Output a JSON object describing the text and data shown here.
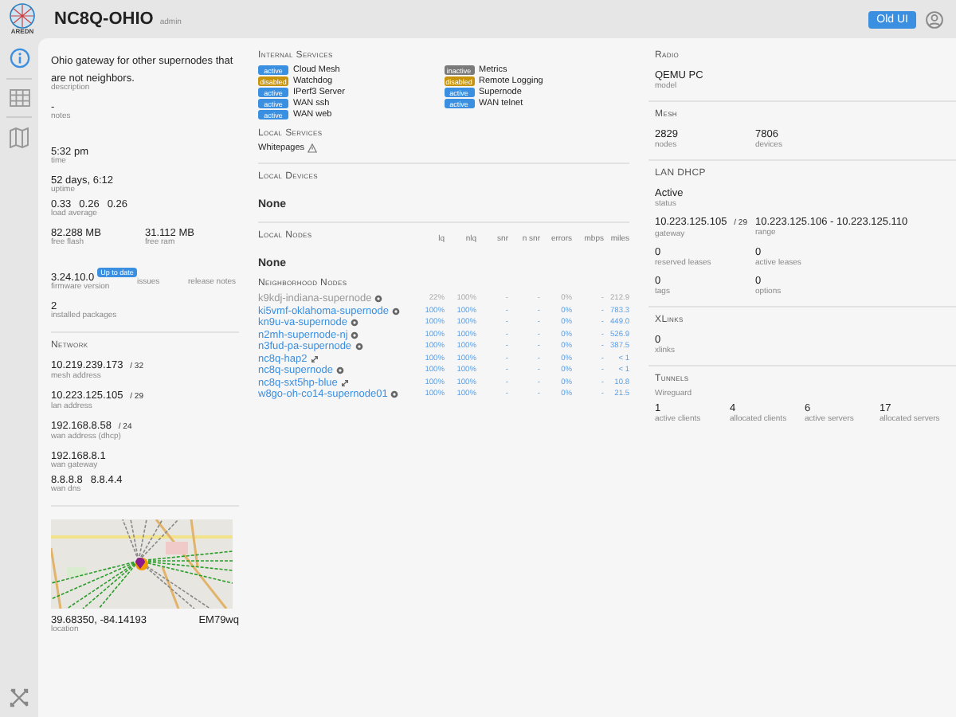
{
  "header": {
    "logo_text": "AREDN",
    "title": "NC8Q-OHIO",
    "role": "admin",
    "old_ui_button": "Old UI"
  },
  "sidebar": {
    "items": [
      {
        "kind": "status",
        "selected": true
      },
      {
        "kind": "table",
        "selected": false
      },
      {
        "kind": "map",
        "selected": false
      }
    ]
  },
  "overview": {
    "rows": [
      {
        "gap_before": false,
        "cells": [
          {
            "value": "Ohio gateway for other supernodes that are not neighbors.",
            "label": "description"
          }
        ]
      },
      {
        "gap_before": false,
        "cells": [
          {
            "value": "-",
            "label": "notes"
          }
        ]
      },
      {
        "gap_before": true,
        "cells": [
          {
            "value": "5:32 pm",
            "label": "time"
          }
        ]
      },
      {
        "gap_before": false,
        "cells": [
          {
            "value": "52 days, 6:12",
            "label": "uptime"
          }
        ]
      },
      {
        "gap_before": false,
        "cells": [
          {
            "values": [
              "0.33",
              "0.26",
              "0.26"
            ],
            "label": "load average"
          }
        ]
      },
      {
        "gap_before": false,
        "cells": [
          {
            "value": "82.288 MB",
            "label": "free flash"
          },
          {
            "value": "31.112 MB",
            "label": "free ram"
          }
        ]
      },
      {
        "gap_before": true,
        "cells": [
          {
            "value": "3.24.10.0",
            "badge": "Up to date",
            "label": "firmware version"
          },
          {
            "label": "issues"
          },
          {
            "label": "release notes"
          }
        ]
      },
      {
        "gap_before": false,
        "cells": [
          {
            "value": "2",
            "label": "installed packages"
          }
        ]
      }
    ]
  },
  "network": {
    "title": "Network",
    "rows": [
      {
        "cells": [
          {
            "value": "10.219.239.173",
            "suffix": "/ 32",
            "label": "mesh address"
          }
        ]
      },
      {
        "cells": [
          {
            "value": "10.223.125.105",
            "suffix": "/ 29",
            "label": "lan address"
          }
        ]
      },
      {
        "cells": [
          {
            "value": "192.168.8.58",
            "suffix": "/ 24",
            "label": "wan address (dhcp)"
          }
        ]
      },
      {
        "cells": [
          {
            "value": "192.168.8.1",
            "label": "wan gateway"
          }
        ]
      },
      {
        "cells": [
          {
            "values": [
              "8.8.8.8",
              "8.8.4.4"
            ],
            "label": "wan dns"
          }
        ]
      }
    ]
  },
  "location": {
    "coordinates": "39.68350, -84.14193",
    "grid_square": "EM79wq",
    "label": "location"
  },
  "internal_services": {
    "title": "Internal Services",
    "items": [
      {
        "status": "active",
        "name": "Cloud Mesh"
      },
      {
        "status": "inactive",
        "name": "Metrics"
      },
      {
        "status": "disabled",
        "name": "Watchdog"
      },
      {
        "status": "disabled",
        "name": "Remote Logging"
      },
      {
        "status": "active",
        "name": "IPerf3 Server"
      },
      {
        "status": "active",
        "name": "Supernode"
      },
      {
        "status": "active",
        "name": "WAN ssh"
      },
      {
        "status": "active",
        "name": "WAN telnet"
      },
      {
        "status": "active",
        "name": "WAN web"
      }
    ]
  },
  "local_services": {
    "title": "Local Services",
    "items": [
      {
        "name": "Whitepages"
      }
    ]
  },
  "local_devices": {
    "title": "Local Devices",
    "value": "None"
  },
  "local_nodes": {
    "title": "Local Nodes",
    "columns": [
      "lq",
      "nlq",
      "snr",
      "n snr",
      "errors",
      "mbps",
      "miles"
    ],
    "value": "None"
  },
  "neighborhood_nodes": {
    "title": "Neighborhood Nodes",
    "rows": [
      {
        "name": "k9kdj-indiana-supernode",
        "kind": "supernode",
        "faded": true,
        "cells": [
          "22%",
          "100%",
          "-",
          "-",
          "0%",
          "-",
          "212.9"
        ]
      },
      {
        "name": "ki5vmf-oklahoma-supernode",
        "kind": "supernode",
        "faded": false,
        "cells": [
          "100%",
          "100%",
          "-",
          "-",
          "0%",
          "-",
          "783.3"
        ]
      },
      {
        "name": "kn9u-va-supernode",
        "kind": "supernode",
        "faded": false,
        "cells": [
          "100%",
          "100%",
          "-",
          "-",
          "0%",
          "-",
          "449.0"
        ]
      },
      {
        "name": "n2mh-supernode-nj",
        "kind": "supernode",
        "faded": false,
        "cells": [
          "100%",
          "100%",
          "-",
          "-",
          "0%",
          "-",
          "526.9"
        ]
      },
      {
        "name": "n3fud-pa-supernode",
        "kind": "supernode",
        "faded": false,
        "cells": [
          "100%",
          "100%",
          "-",
          "-",
          "0%",
          "-",
          "387.5"
        ]
      },
      {
        "name": "nc8q-hap2",
        "kind": "tunnel",
        "faded": false,
        "cells": [
          "100%",
          "100%",
          "-",
          "-",
          "0%",
          "-",
          "< 1"
        ]
      },
      {
        "name": "nc8q-supernode",
        "kind": "supernode",
        "faded": false,
        "cells": [
          "100%",
          "100%",
          "-",
          "-",
          "0%",
          "-",
          "< 1"
        ]
      },
      {
        "name": "nc8q-sxt5hp-blue",
        "kind": "tunnel",
        "faded": false,
        "cells": [
          "100%",
          "100%",
          "-",
          "-",
          "0%",
          "-",
          "10.8"
        ]
      },
      {
        "name": "w8go-oh-co14-supernode01",
        "kind": "supernode",
        "faded": false,
        "cells": [
          "100%",
          "100%",
          "-",
          "-",
          "0%",
          "-",
          "21.5"
        ]
      }
    ]
  },
  "radio": {
    "title": "Radio",
    "rows": [
      {
        "cells": [
          {
            "value": "QEMU PC",
            "label": "model"
          }
        ]
      }
    ]
  },
  "mesh": {
    "title": "Mesh",
    "rows": [
      {
        "cells": [
          {
            "value": "2829",
            "label": "nodes"
          },
          {
            "value": "7806",
            "label": "devices"
          }
        ]
      }
    ]
  },
  "lan_dhcp": {
    "title": "LAN DHCP",
    "rows": [
      {
        "cells": [
          {
            "value": "Active",
            "label": "status"
          }
        ]
      },
      {
        "cells": [
          {
            "value": "10.223.125.105",
            "suffix": "/ 29",
            "label": "gateway"
          },
          {
            "value": "10.223.125.106 - 10.223.125.110",
            "label": "range"
          }
        ]
      },
      {
        "cells": [
          {
            "value": "0",
            "label": "reserved leases"
          },
          {
            "value": "0",
            "label": "active leases"
          }
        ]
      },
      {
        "cells": [
          {
            "value": "0",
            "label": "tags"
          },
          {
            "value": "0",
            "label": "options"
          }
        ]
      }
    ]
  },
  "xlinks": {
    "title": "XLinks",
    "rows": [
      {
        "cells": [
          {
            "value": "0",
            "label": "xlinks"
          }
        ]
      }
    ]
  },
  "tunnels": {
    "title": "Tunnels",
    "subtitle": "Wireguard",
    "rows": [
      {
        "cells": [
          {
            "value": "1",
            "label": "active clients"
          },
          {
            "value": "4",
            "label": "allocated clients"
          },
          {
            "value": "6",
            "label": "active servers"
          },
          {
            "value": "17",
            "label": "allocated servers"
          }
        ]
      }
    ]
  }
}
